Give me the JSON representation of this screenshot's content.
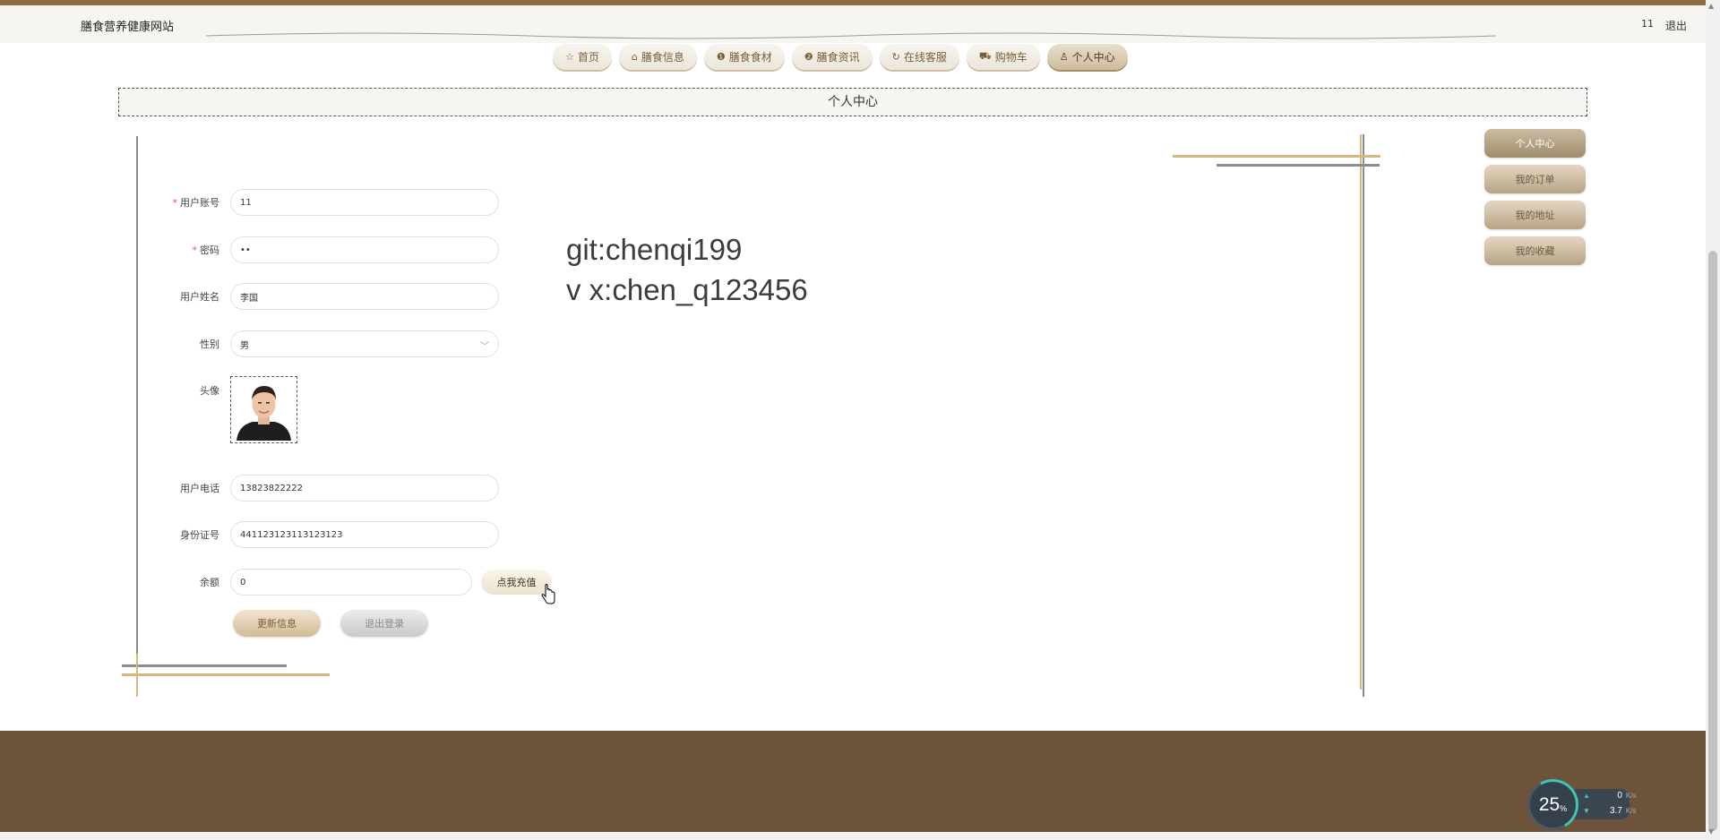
{
  "site": {
    "title": "膳食营养健康网站"
  },
  "topbar": {
    "username": "11",
    "logout_label": "退出"
  },
  "nav": {
    "items": [
      {
        "label": "首页",
        "icon": "star-icon",
        "glyph": "☆"
      },
      {
        "label": "膳食信息",
        "icon": "bag-icon",
        "glyph": "⌂"
      },
      {
        "label": "膳食食材",
        "icon": "info-icon",
        "glyph": "❶"
      },
      {
        "label": "膳食资讯",
        "icon": "question-icon",
        "glyph": "❷"
      },
      {
        "label": "在线客服",
        "icon": "headset-icon",
        "glyph": "↻"
      },
      {
        "label": "购物车",
        "icon": "cart-icon",
        "glyph": "⛟"
      },
      {
        "label": "个人中心",
        "icon": "user-icon",
        "glyph": "♙"
      }
    ],
    "active": "个人中心"
  },
  "section": {
    "title": "个人中心"
  },
  "form": {
    "account": {
      "label": "用户账号",
      "value": "11",
      "required_mark": "*"
    },
    "password": {
      "label": "密码",
      "value": "••",
      "required_mark": "*"
    },
    "name": {
      "label": "用户姓名",
      "value": "李国"
    },
    "gender": {
      "label": "性别",
      "value": "男"
    },
    "avatar": {
      "label": "头像"
    },
    "phone": {
      "label": "用户电话",
      "value": "13823822222"
    },
    "id_card": {
      "label": "身份证号",
      "value": "441123123113123123"
    },
    "balance": {
      "label": "余额",
      "value": "0",
      "recharge_label": "点我充值"
    },
    "update_label": "更新信息",
    "logout_label": "退出登录"
  },
  "watermark": {
    "line1": "git:chenqi199",
    "line2": "v x:chen_q123456"
  },
  "side_menu": {
    "items": [
      {
        "label": "个人中心"
      },
      {
        "label": "我的订单"
      },
      {
        "label": "我的地址"
      },
      {
        "label": "我的收藏"
      }
    ]
  },
  "net_widget": {
    "percent": "25",
    "percent_unit": "%",
    "upload": "0",
    "download": "3.7",
    "unit": "K/s"
  },
  "colors": {
    "accent": "#8d6a3f",
    "footer": "#6d5339",
    "required": "#e5533d"
  }
}
